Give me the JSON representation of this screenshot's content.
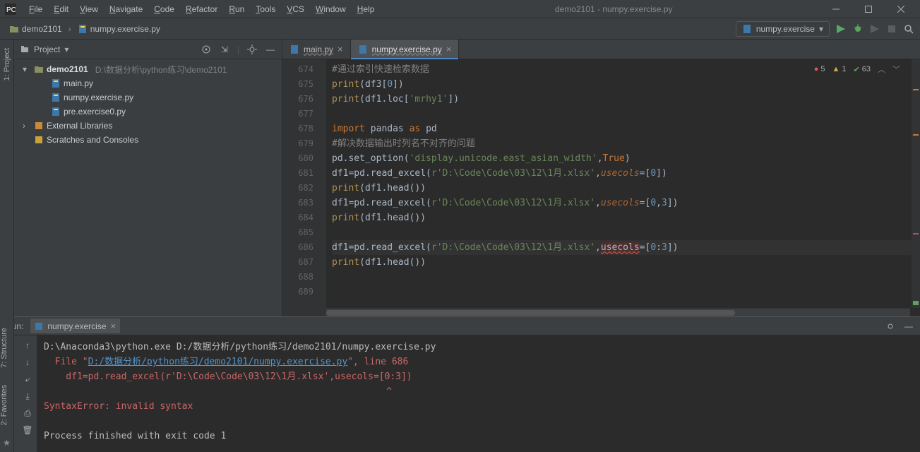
{
  "window": {
    "title": "demo2101 - numpy.exercise.py"
  },
  "menu": [
    "File",
    "Edit",
    "View",
    "Navigate",
    "Code",
    "Refactor",
    "Run",
    "Tools",
    "VCS",
    "Window",
    "Help"
  ],
  "breadcrumb": {
    "root": "demo2101",
    "file": "numpy.exercise.py"
  },
  "runConfig": {
    "name": "numpy.exercise"
  },
  "project": {
    "title": "Project",
    "root": {
      "name": "demo2101",
      "path": "D:\\数据分析\\python练习\\demo2101"
    },
    "files": [
      "main.py",
      "numpy.exercise.py",
      "pre.exercise0.py"
    ],
    "extLibs": "External Libraries",
    "scratches": "Scratches and Consoles"
  },
  "tabs": [
    {
      "name": "main.py",
      "active": false
    },
    {
      "name": "numpy.exercise.py",
      "active": true
    }
  ],
  "lines": {
    "start": 674,
    "count": 16,
    "code": [
      {
        "indent": 0,
        "tokens": [
          {
            "t": "#通过索引快速检索数据",
            "c": "c-comment"
          }
        ]
      },
      {
        "indent": 0,
        "tokens": [
          {
            "t": "print",
            "c": "c-fn"
          },
          {
            "t": "(df3["
          },
          {
            "t": "0",
            "c": "c-num"
          },
          {
            "t": "])"
          }
        ]
      },
      {
        "indent": 0,
        "tokens": [
          {
            "t": "print",
            "c": "c-fn"
          },
          {
            "t": "(df1.loc["
          },
          {
            "t": "'mrhy1'",
            "c": "c-str"
          },
          {
            "t": "])"
          }
        ]
      },
      {
        "indent": 0,
        "tokens": []
      },
      {
        "indent": 0,
        "tokens": [
          {
            "t": "import ",
            "c": "c-kw"
          },
          {
            "t": "pandas "
          },
          {
            "t": "as ",
            "c": "c-kw"
          },
          {
            "t": "pd"
          }
        ]
      },
      {
        "indent": 0,
        "tokens": [
          {
            "t": "#解决数据输出时列名不对齐的问题",
            "c": "c-comment"
          }
        ]
      },
      {
        "indent": 0,
        "tokens": [
          {
            "t": "pd.set_option("
          },
          {
            "t": "'display.unicode.east_asian_width'",
            "c": "c-str"
          },
          {
            "t": ","
          },
          {
            "t": "True",
            "c": "c-kw"
          },
          {
            "t": ")"
          }
        ]
      },
      {
        "indent": 0,
        "tokens": [
          {
            "t": "df1=pd.read_excel("
          },
          {
            "t": "r'D:\\Code\\Code\\03\\12\\1月.xlsx'",
            "c": "c-str"
          },
          {
            "t": ","
          },
          {
            "t": "usecols",
            "c": "c-param"
          },
          {
            "t": "=["
          },
          {
            "t": "0",
            "c": "c-num"
          },
          {
            "t": "])"
          }
        ]
      },
      {
        "indent": 0,
        "tokens": [
          {
            "t": "print",
            "c": "c-fn"
          },
          {
            "t": "(df1.head())"
          }
        ]
      },
      {
        "indent": 0,
        "tokens": [
          {
            "t": "df1=pd.read_excel("
          },
          {
            "t": "r'D:\\Code\\Code\\03\\12\\1月.xlsx'",
            "c": "c-str"
          },
          {
            "t": ","
          },
          {
            "t": "usecols",
            "c": "c-param"
          },
          {
            "t": "=["
          },
          {
            "t": "0",
            "c": "c-num"
          },
          {
            "t": ","
          },
          {
            "t": "3",
            "c": "c-num"
          },
          {
            "t": "])"
          }
        ]
      },
      {
        "indent": 0,
        "tokens": [
          {
            "t": "print",
            "c": "c-fn"
          },
          {
            "t": "(df1.head())"
          }
        ]
      },
      {
        "indent": 0,
        "tokens": []
      },
      {
        "indent": 0,
        "current": true,
        "tokens": [
          {
            "t": "df1=pd.read_excel("
          },
          {
            "t": "r'D:\\Code\\Code\\03\\12\\1月.xlsx'",
            "c": "c-str"
          },
          {
            "t": ","
          },
          {
            "t": "usecols",
            "c": "c-err"
          },
          {
            "t": "=["
          },
          {
            "t": "0",
            "c": "c-num"
          },
          {
            "t": ":"
          },
          {
            "t": "3",
            "c": "c-num"
          },
          {
            "t": "])"
          }
        ]
      },
      {
        "indent": 0,
        "tokens": [
          {
            "t": "print",
            "c": "c-fn"
          },
          {
            "t": "(df1.head())"
          }
        ]
      },
      {
        "indent": 0,
        "tokens": []
      },
      {
        "indent": 0,
        "tokens": []
      }
    ]
  },
  "inspections": {
    "errors": "5",
    "warnings": "1",
    "ok": "63"
  },
  "run": {
    "label": "Run:",
    "tab": "numpy.exercise",
    "output": [
      {
        "frags": [
          {
            "t": "D:\\Anaconda3\\python.exe D:/数据分析/python练习/demo2101/numpy.exercise.py"
          }
        ]
      },
      {
        "frags": [
          {
            "t": "  File \"",
            "c": "err"
          },
          {
            "t": "D:/数据分析/python练习/demo2101/numpy.exercise.py",
            "c": "link"
          },
          {
            "t": "\", line 686",
            "c": "err"
          }
        ]
      },
      {
        "frags": [
          {
            "t": "    df1=pd.read_excel(r'D:\\Code\\Code\\03\\12\\1月.xlsx',usecols=[0:3])",
            "c": "err"
          }
        ]
      },
      {
        "frags": [
          {
            "t": "                                                              ^",
            "c": "err"
          }
        ]
      },
      {
        "frags": [
          {
            "t": "SyntaxError: invalid syntax",
            "c": "err"
          }
        ]
      },
      {
        "frags": []
      },
      {
        "frags": [
          {
            "t": "Process finished with exit code 1"
          }
        ]
      }
    ]
  },
  "rails": {
    "project": "1: Project",
    "structure": "7: Structure",
    "favorites": "2: Favorites"
  }
}
